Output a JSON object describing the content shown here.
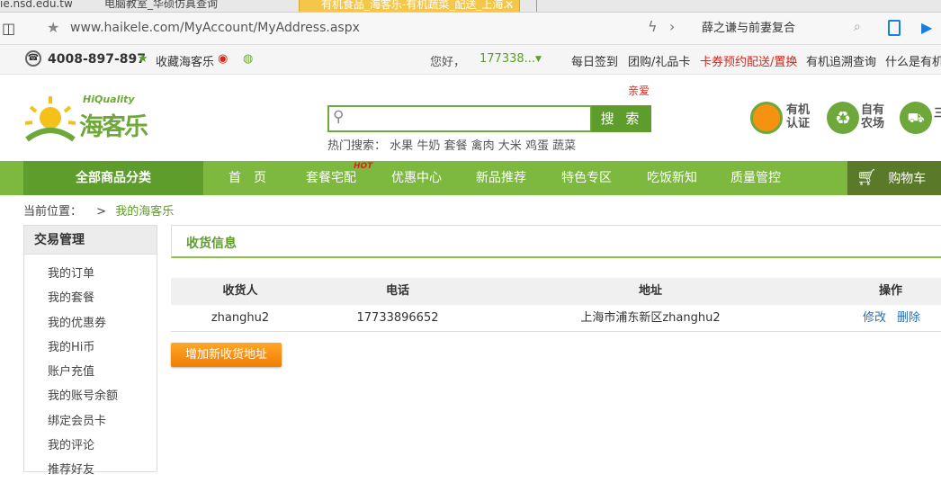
{
  "browser": {
    "tabs": [
      {
        "label": "ie.nsd.edu.tw/..."
      },
      {
        "label": "电脑教室_华硕仿真查询"
      },
      {
        "label": "有机食品_海客乐-有机蔬菜_配送_上海..."
      }
    ],
    "url": "www.haikele.com/MyAccount/MyAddress.aspx",
    "search_text": "薛之谦与前妻复合"
  },
  "infobar": {
    "phone": "4008-897-897",
    "favorite": "收藏海客乐",
    "greeting": "您好，",
    "username": "177338...",
    "links": [
      "每日签到",
      "团购/礼品卡",
      "卡券预约配送/置换",
      "有机追溯查询",
      "什么是有机"
    ]
  },
  "header": {
    "logo_text": "海客乐",
    "logo_sub": "HiQuality",
    "promo": "亲爱",
    "search_button": "搜 索",
    "hot_label": "热门搜索：",
    "hot_words": [
      "水果",
      "牛奶",
      "套餐",
      "禽肉",
      "大米",
      "鸡蛋",
      "蔬菜"
    ],
    "badges": [
      {
        "line1": "有机",
        "line2": "认证"
      },
      {
        "line1": "自有",
        "line2": "农场"
      },
      {
        "line1": "三",
        "line2": ""
      }
    ]
  },
  "nav": {
    "all_label": "全部商品分类",
    "items": [
      "首　页",
      "套餐宅配",
      "优惠中心",
      "新品推荐",
      "特色专区",
      "吃饭新知",
      "质量管控"
    ],
    "hot_badge": "HOT",
    "cart": "购物车"
  },
  "breadcrumb": {
    "label": "当前位置：",
    "sep": ">",
    "current": "我的海客乐"
  },
  "sidebar": {
    "title": "交易管理",
    "items": [
      "我的订单",
      "我的套餐",
      "我的优惠券",
      "我的Hi币",
      "账户充值",
      "我的账号余额",
      "绑定会员卡",
      "我的评论",
      "推荐好友"
    ]
  },
  "main": {
    "title": "收货信息",
    "columns": [
      "收货人",
      "电话",
      "地址",
      "操作"
    ],
    "rows": [
      {
        "name": "zhanghu2",
        "phone": "17733896652",
        "address": "上海市浦东新区zhanghu2",
        "edit": "修改",
        "delete": "删除"
      }
    ],
    "add_button": "增加新收货地址"
  },
  "colors": {
    "brand_green": "#7db83f",
    "dark_green": "#5e9c2b",
    "orange": "#f59210",
    "link_blue": "#2a6fb8",
    "red": "#d9261c"
  }
}
